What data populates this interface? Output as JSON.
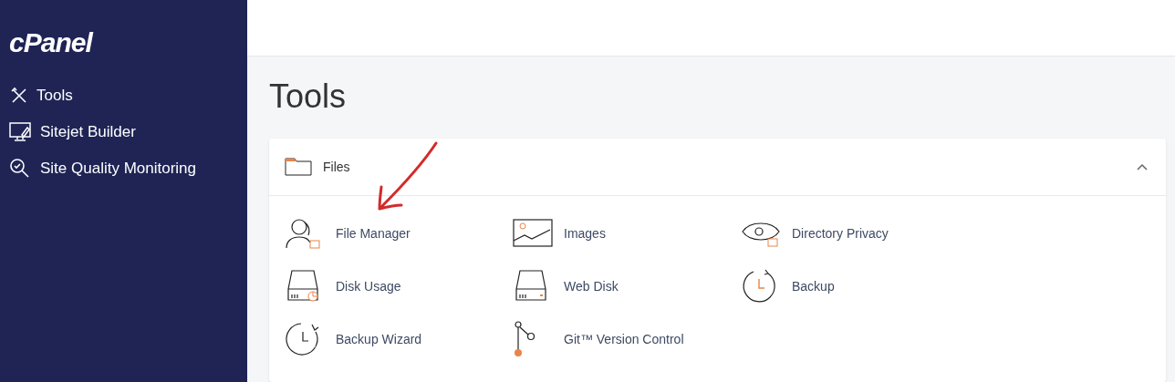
{
  "sidebar": {
    "logo": "cPanel",
    "items": [
      {
        "label": "Tools"
      },
      {
        "label": "Sitejet Builder"
      },
      {
        "label": "Site Quality Monitoring"
      }
    ]
  },
  "page": {
    "title": "Tools"
  },
  "section": {
    "title": "Files",
    "expanded": true,
    "items": [
      {
        "label": "File Manager"
      },
      {
        "label": "Images"
      },
      {
        "label": "Directory Privacy"
      },
      {
        "label": "Disk Usage"
      },
      {
        "label": "Web Disk"
      },
      {
        "label": "Backup"
      },
      {
        "label": "Backup Wizard"
      },
      {
        "label": "Git™ Version Control"
      }
    ]
  }
}
